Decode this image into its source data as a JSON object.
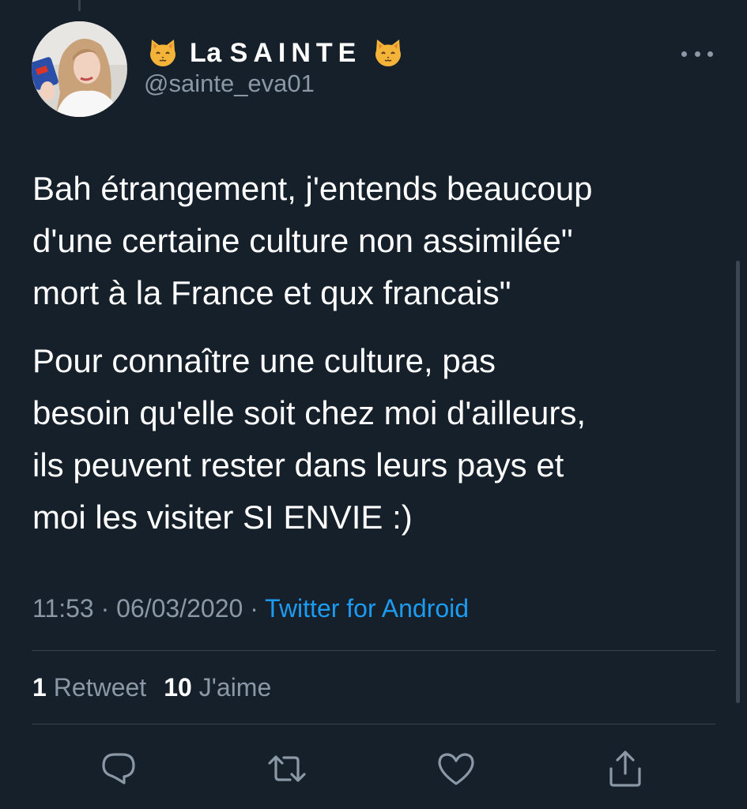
{
  "author": {
    "name_prefix": "La",
    "name_caps": "SAINTE",
    "handle": "@sainte_eva01",
    "emoji_left": "cat-face-icon",
    "emoji_right": "cat-face-icon"
  },
  "tweet": {
    "paragraphs": [
      "Bah étrangement, j'entends beaucoup\nd'une certaine culture non assimilée\"\nmort à la France et qux francais\"",
      "Pour connaître une culture, pas\nbesoin qu'elle soit chez moi d'ailleurs,\nils peuvent rester dans leurs pays et\nmoi les visiter SI ENVIE :)"
    ],
    "time": "11:53",
    "separator": "·",
    "date": "06/03/2020",
    "source": "Twitter for Android"
  },
  "stats": {
    "retweets_count": "1",
    "retweets_label": "Retweet",
    "likes_count": "10",
    "likes_label": "J'aime"
  },
  "actions": [
    "reply-icon",
    "retweet-icon",
    "like-icon",
    "share-icon"
  ],
  "colors": {
    "background": "#15202b",
    "text": "#ffffff",
    "secondary_text": "#8b98a5",
    "link": "#1d9bf0",
    "divider": "#38444d"
  }
}
